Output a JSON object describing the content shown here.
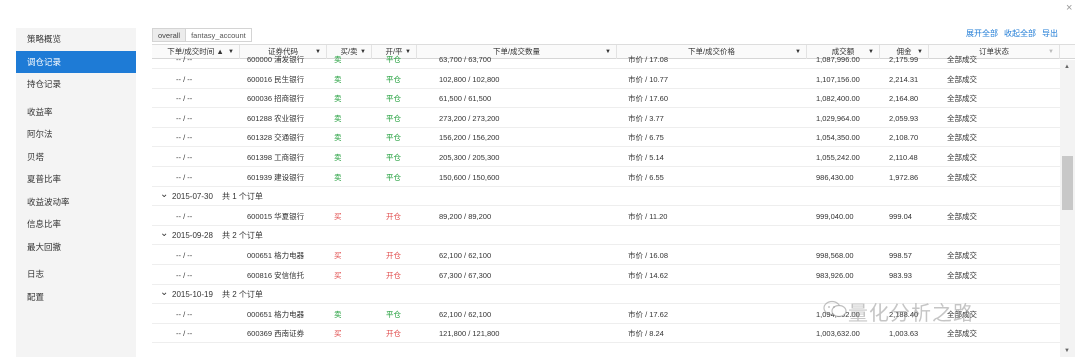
{
  "close_label": "×",
  "sidebar": {
    "groups": [
      [
        "策略概览",
        "调仓记录",
        "持仓记录"
      ],
      [
        "收益率",
        "阿尔法",
        "贝塔",
        "夏普比率",
        "收益波动率",
        "信息比率",
        "最大回撤"
      ],
      [
        "日志",
        "配置"
      ]
    ],
    "active": "调仓记录"
  },
  "tabs": [
    "overall",
    "fantasy_account"
  ],
  "active_tab": "overall",
  "top_links": [
    "展开全部",
    "收起全部",
    "导出"
  ],
  "columns": [
    "下单/成交时间 ▲",
    "证券代码",
    "买/卖",
    "开/平",
    "下单/成交数量",
    "下单/成交价格",
    "成交额",
    "佣金",
    "订单状态"
  ],
  "rows": [
    {
      "kind": "order",
      "time": "-- / --",
      "code": "600000 浦发银行",
      "side": "卖",
      "oc": "平仓",
      "qty": "63,700 / 63,700",
      "price": "市价 / 17.08",
      "amount": "1,087,996.00",
      "fee": "2,175.99",
      "status": "全部成交"
    },
    {
      "kind": "order",
      "time": "-- / --",
      "code": "600016 民生银行",
      "side": "卖",
      "oc": "平仓",
      "qty": "102,800 / 102,800",
      "price": "市价 / 10.77",
      "amount": "1,107,156.00",
      "fee": "2,214.31",
      "status": "全部成交"
    },
    {
      "kind": "order",
      "time": "-- / --",
      "code": "600036 招商银行",
      "side": "卖",
      "oc": "平仓",
      "qty": "61,500 / 61,500",
      "price": "市价 / 17.60",
      "amount": "1,082,400.00",
      "fee": "2,164.80",
      "status": "全部成交"
    },
    {
      "kind": "order",
      "time": "-- / --",
      "code": "601288 农业银行",
      "side": "卖",
      "oc": "平仓",
      "qty": "273,200 / 273,200",
      "price": "市价 / 3.77",
      "amount": "1,029,964.00",
      "fee": "2,059.93",
      "status": "全部成交"
    },
    {
      "kind": "order",
      "time": "-- / --",
      "code": "601328 交通银行",
      "side": "卖",
      "oc": "平仓",
      "qty": "156,200 / 156,200",
      "price": "市价 / 6.75",
      "amount": "1,054,350.00",
      "fee": "2,108.70",
      "status": "全部成交"
    },
    {
      "kind": "order",
      "time": "-- / --",
      "code": "601398 工商银行",
      "side": "卖",
      "oc": "平仓",
      "qty": "205,300 / 205,300",
      "price": "市价 / 5.14",
      "amount": "1,055,242.00",
      "fee": "2,110.48",
      "status": "全部成交"
    },
    {
      "kind": "order",
      "time": "-- / --",
      "code": "601939 建设银行",
      "side": "卖",
      "oc": "平仓",
      "qty": "150,600 / 150,600",
      "price": "市价 / 6.55",
      "amount": "986,430.00",
      "fee": "1,972.86",
      "status": "全部成交"
    },
    {
      "kind": "group",
      "date": "2015-07-30",
      "summary": "共 1 个订单"
    },
    {
      "kind": "order",
      "time": "-- / --",
      "code": "600015 华夏银行",
      "side": "买",
      "oc": "开仓",
      "qty": "89,200 / 89,200",
      "price": "市价 / 11.20",
      "amount": "999,040.00",
      "fee": "999.04",
      "status": "全部成交"
    },
    {
      "kind": "group",
      "date": "2015-09-28",
      "summary": "共 2 个订单"
    },
    {
      "kind": "order",
      "time": "-- / --",
      "code": "000651 格力电器",
      "side": "买",
      "oc": "开仓",
      "qty": "62,100 / 62,100",
      "price": "市价 / 16.08",
      "amount": "998,568.00",
      "fee": "998.57",
      "status": "全部成交"
    },
    {
      "kind": "order",
      "time": "-- / --",
      "code": "600816 安信信托",
      "side": "买",
      "oc": "开仓",
      "qty": "67,300 / 67,300",
      "price": "市价 / 14.62",
      "amount": "983,926.00",
      "fee": "983.93",
      "status": "全部成交"
    },
    {
      "kind": "group",
      "date": "2015-10-19",
      "summary": "共 2 个订单"
    },
    {
      "kind": "order",
      "time": "-- / --",
      "code": "000651 格力电器",
      "side": "卖",
      "oc": "平仓",
      "qty": "62,100 / 62,100",
      "price": "市价 / 17.62",
      "amount": "1,094,202.00",
      "fee": "2,188.40",
      "status": "全部成交"
    },
    {
      "kind": "order",
      "time": "-- / --",
      "code": "600369 西南证券",
      "side": "买",
      "oc": "开仓",
      "qty": "121,800 / 121,800",
      "price": "市价 / 8.24",
      "amount": "1,003,632.00",
      "fee": "1,003.63",
      "status": "全部成交"
    }
  ],
  "colors": {
    "accent": "#1e7bd6",
    "buy": "#e04848",
    "sell": "#1f9e3a"
  },
  "watermark": "量化分析之路",
  "icons": {
    "filter": "filter-icon",
    "expand": "chevron-down-icon",
    "close": "close-icon"
  }
}
